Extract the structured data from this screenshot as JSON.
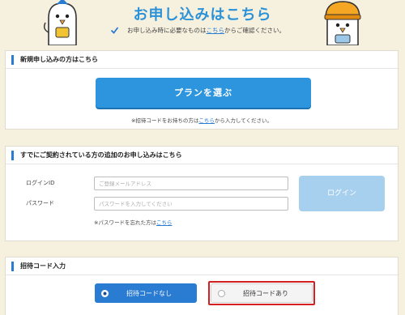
{
  "header": {
    "title": "お申し込みはこちら",
    "notice_prefix": "お申し込み時に必要なものは",
    "notice_link": "こちら",
    "notice_suffix": "からご確認ください。"
  },
  "new_signup": {
    "section_title": "新規申し込みの方はこちら",
    "plan_button": "プランを選ぶ",
    "invite_note_prefix": "※招待コードをお持ちの方は",
    "invite_note_link": "こちら",
    "invite_note_suffix": "から入力してください。"
  },
  "existing": {
    "section_title": "すでにご契約されている方の追加のお申し込みはこちら",
    "login_id_label": "ログインID",
    "login_id_placeholder": "ご登録メールアドレス",
    "password_label": "パスワード",
    "password_placeholder": "パスワードを入力してください",
    "login_button": "ログイン",
    "forgot_prefix": "※パスワードを忘れた方は",
    "forgot_link": "こちら"
  },
  "invite_code": {
    "section_title": "招待コード入力",
    "option_none": "招待コードなし",
    "option_has": "招待コードあり",
    "selected": "招待コードなし"
  },
  "colors": {
    "accent": "#2a7bd2",
    "title": "#2a92d8",
    "highlight": "#d42020",
    "background": "#f6f0de"
  },
  "icons": [
    "check-icon",
    "mascot-bird-left",
    "mascot-bird-right-hat",
    "radio-selected-icon",
    "radio-unselected-icon"
  ]
}
